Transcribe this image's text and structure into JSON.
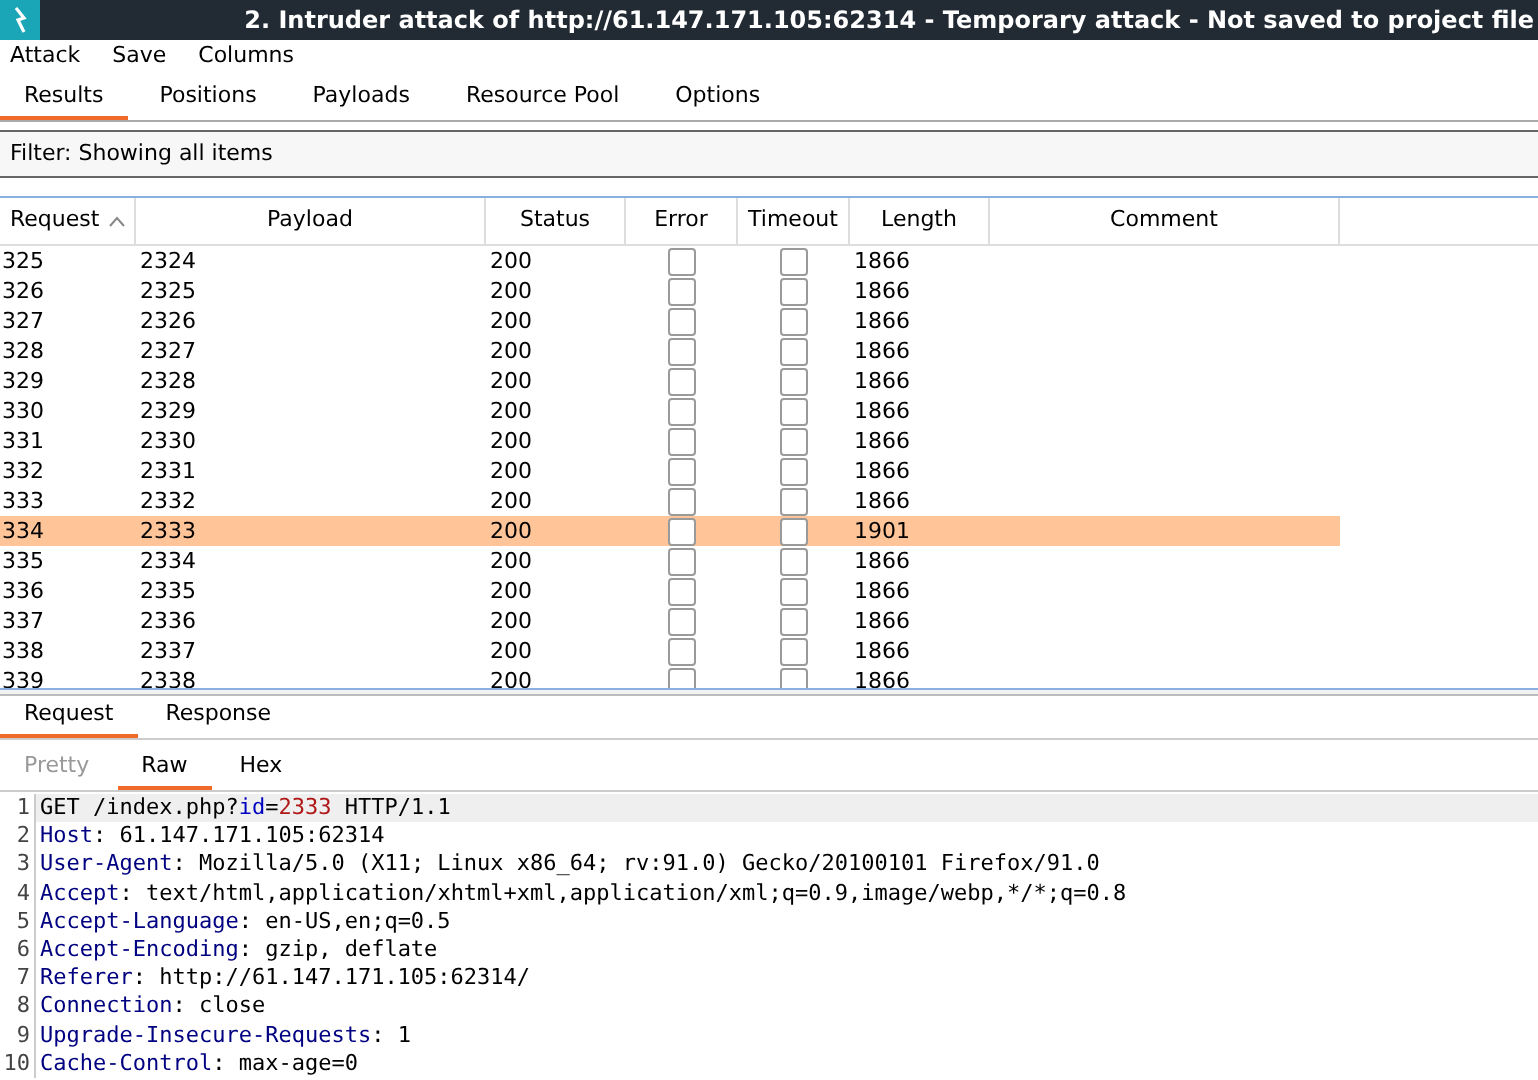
{
  "window": {
    "title": "2. Intruder attack of http://61.147.171.105:62314 - Temporary attack - Not saved to project file"
  },
  "menu": [
    "Attack",
    "Save",
    "Columns"
  ],
  "tabs": [
    {
      "label": "Results",
      "selected": true
    },
    {
      "label": "Positions",
      "selected": false
    },
    {
      "label": "Payloads",
      "selected": false
    },
    {
      "label": "Resource Pool",
      "selected": false
    },
    {
      "label": "Options",
      "selected": false
    }
  ],
  "filter": "Filter: Showing all items",
  "table": {
    "columns": [
      {
        "label": "Request",
        "sorted": true
      },
      {
        "label": "Payload",
        "sorted": false
      },
      {
        "label": "Status",
        "sorted": false
      },
      {
        "label": "Error",
        "sorted": false
      },
      {
        "label": "Timeout",
        "sorted": false
      },
      {
        "label": "Length",
        "sorted": false
      },
      {
        "label": "Comment",
        "sorted": false
      }
    ],
    "rows": [
      {
        "request": "325",
        "payload": "2324",
        "status": "200",
        "error": false,
        "timeout": false,
        "length": "1866",
        "selected": false
      },
      {
        "request": "326",
        "payload": "2325",
        "status": "200",
        "error": false,
        "timeout": false,
        "length": "1866",
        "selected": false
      },
      {
        "request": "327",
        "payload": "2326",
        "status": "200",
        "error": false,
        "timeout": false,
        "length": "1866",
        "selected": false
      },
      {
        "request": "328",
        "payload": "2327",
        "status": "200",
        "error": false,
        "timeout": false,
        "length": "1866",
        "selected": false
      },
      {
        "request": "329",
        "payload": "2328",
        "status": "200",
        "error": false,
        "timeout": false,
        "length": "1866",
        "selected": false
      },
      {
        "request": "330",
        "payload": "2329",
        "status": "200",
        "error": false,
        "timeout": false,
        "length": "1866",
        "selected": false
      },
      {
        "request": "331",
        "payload": "2330",
        "status": "200",
        "error": false,
        "timeout": false,
        "length": "1866",
        "selected": false
      },
      {
        "request": "332",
        "payload": "2331",
        "status": "200",
        "error": false,
        "timeout": false,
        "length": "1866",
        "selected": false
      },
      {
        "request": "333",
        "payload": "2332",
        "status": "200",
        "error": false,
        "timeout": false,
        "length": "1866",
        "selected": false
      },
      {
        "request": "334",
        "payload": "2333",
        "status": "200",
        "error": false,
        "timeout": false,
        "length": "1901",
        "selected": true
      },
      {
        "request": "335",
        "payload": "2334",
        "status": "200",
        "error": false,
        "timeout": false,
        "length": "1866",
        "selected": false
      },
      {
        "request": "336",
        "payload": "2335",
        "status": "200",
        "error": false,
        "timeout": false,
        "length": "1866",
        "selected": false
      },
      {
        "request": "337",
        "payload": "2336",
        "status": "200",
        "error": false,
        "timeout": false,
        "length": "1866",
        "selected": false
      },
      {
        "request": "338",
        "payload": "2337",
        "status": "200",
        "error": false,
        "timeout": false,
        "length": "1866",
        "selected": false
      },
      {
        "request": "339",
        "payload": "2338",
        "status": "200",
        "error": false,
        "timeout": false,
        "length": "1866",
        "selected": false
      }
    ]
  },
  "message_tabs": [
    {
      "label": "Request",
      "selected": true
    },
    {
      "label": "Response",
      "selected": false
    }
  ],
  "view_tabs": [
    {
      "label": "Pretty",
      "selected": false,
      "disabled": true
    },
    {
      "label": "Raw",
      "selected": true,
      "disabled": false
    },
    {
      "label": "Hex",
      "selected": false,
      "disabled": false
    }
  ],
  "editor": {
    "lines": [
      {
        "number": "1",
        "tokens": [
          {
            "kind": "plain",
            "text": "GET /index.php?"
          },
          {
            "kind": "param",
            "text": "id"
          },
          {
            "kind": "plain",
            "text": "="
          },
          {
            "kind": "value",
            "text": "2333"
          },
          {
            "kind": "plain",
            "text": " HTTP/1.1"
          }
        ]
      },
      {
        "number": "2",
        "tokens": [
          {
            "kind": "key",
            "text": "Host"
          },
          {
            "kind": "plain",
            "text": ": 61.147.171.105:62314"
          }
        ]
      },
      {
        "number": "3",
        "tokens": [
          {
            "kind": "key",
            "text": "User-Agent"
          },
          {
            "kind": "plain",
            "text": ": Mozilla/5.0 (X11; Linux x86_64; rv:91.0) Gecko/20100101 Firefox/91.0"
          }
        ]
      },
      {
        "number": "4",
        "tokens": [
          {
            "kind": "key",
            "text": "Accept"
          },
          {
            "kind": "plain",
            "text": ": text/html,application/xhtml+xml,application/xml;q=0.9,image/webp,*/*;q=0.8"
          }
        ]
      },
      {
        "number": "5",
        "tokens": [
          {
            "kind": "key",
            "text": "Accept-Language"
          },
          {
            "kind": "plain",
            "text": ": en-US,en;q=0.5"
          }
        ]
      },
      {
        "number": "6",
        "tokens": [
          {
            "kind": "key",
            "text": "Accept-Encoding"
          },
          {
            "kind": "plain",
            "text": ": gzip, deflate"
          }
        ]
      },
      {
        "number": "7",
        "tokens": [
          {
            "kind": "key",
            "text": "Referer"
          },
          {
            "kind": "plain",
            "text": ": http://61.147.171.105:62314/"
          }
        ]
      },
      {
        "number": "8",
        "tokens": [
          {
            "kind": "key",
            "text": "Connection"
          },
          {
            "kind": "plain",
            "text": ": close"
          }
        ]
      },
      {
        "number": "9",
        "tokens": [
          {
            "kind": "key",
            "text": "Upgrade-Insecure-Requests"
          },
          {
            "kind": "plain",
            "text": ": 1"
          }
        ]
      },
      {
        "number": "10",
        "tokens": [
          {
            "kind": "key",
            "text": "Cache-Control"
          },
          {
            "kind": "plain",
            "text": ": max-age=0"
          }
        ]
      }
    ]
  }
}
